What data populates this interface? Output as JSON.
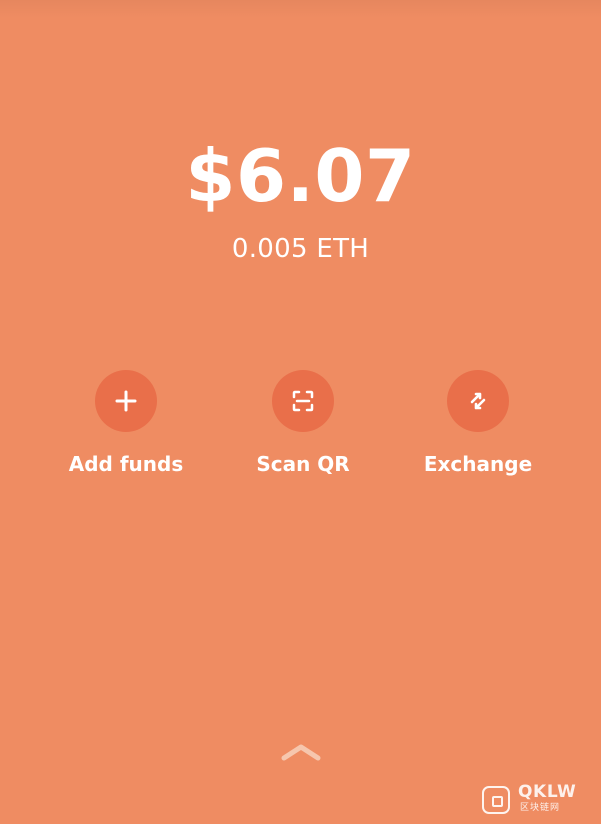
{
  "colors": {
    "background": "#ef8c62",
    "action_circle": "#e96f4a",
    "text": "#ffffff",
    "handle": "#f6c6ad"
  },
  "balance": {
    "usd": "$6.07",
    "eth": "0.005 ETH"
  },
  "actions": [
    {
      "label": "Add funds",
      "icon": "plus-icon"
    },
    {
      "label": "Scan QR",
      "icon": "scan-qr-icon"
    },
    {
      "label": "Exchange",
      "icon": "exchange-icon"
    }
  ],
  "drawer": {
    "icon": "chevron-up-icon"
  },
  "watermark": {
    "brand": "QKLW",
    "subtitle": "区块链网"
  }
}
